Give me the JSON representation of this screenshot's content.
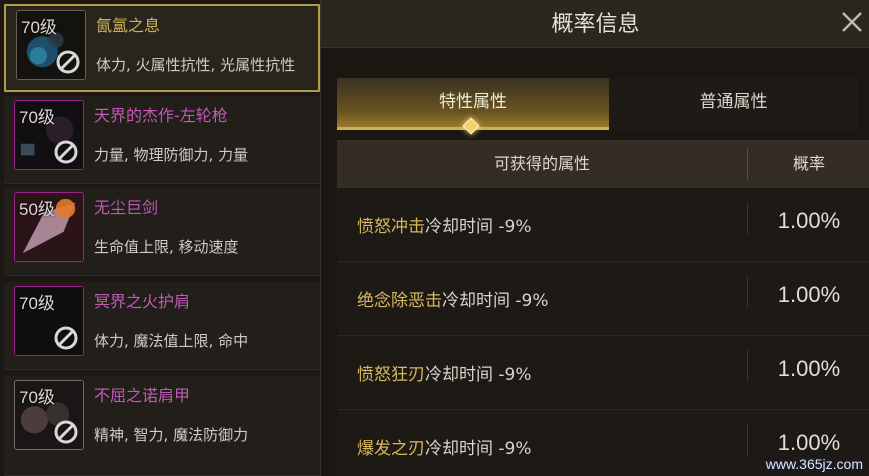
{
  "item_list": [
    {
      "level": "70级",
      "name": "氤氲之息",
      "stats": "体力, 火属性抗性, 光属性抗性",
      "name_color": "gold",
      "selected": true
    },
    {
      "level": "70级",
      "name": "天界的杰作-左轮枪",
      "stats": "力量, 物理防御力, 力量",
      "name_color": "magenta",
      "selected": false
    },
    {
      "level": "50级",
      "name": "无尘巨剑",
      "stats": "生命值上限, 移动速度",
      "name_color": "magenta",
      "selected": false
    },
    {
      "level": "70级",
      "name": "冥界之火护肩",
      "stats": "体力, 魔法值上限, 命中",
      "name_color": "magenta",
      "selected": false
    },
    {
      "level": "70级",
      "name": "不屈之诺肩甲",
      "stats": "精神, 智力, 魔法防御力",
      "name_color": "magenta",
      "selected": false
    }
  ],
  "modal": {
    "title": "概率信息",
    "tabs": [
      {
        "label": "特性属性",
        "active": true
      },
      {
        "label": "普通属性",
        "active": false
      }
    ],
    "table_headers": {
      "attribute": "可获得的属性",
      "probability": "概率"
    },
    "rows": [
      {
        "skill": "愤怒冲击",
        "effect": "冷却时间 -9%",
        "probability": "1.00%"
      },
      {
        "skill": "绝念除恶击",
        "effect": "冷却时间 -9%",
        "probability": "1.00%"
      },
      {
        "skill": "愤怒狂刃",
        "effect": "冷却时间 -9%",
        "probability": "1.00%"
      },
      {
        "skill": "爆发之刃",
        "effect": "冷却时间 -9%",
        "probability": "1.00%"
      }
    ]
  },
  "watermark": "www.365jz.com",
  "colors": {
    "gold_text": "#d6b760",
    "magenta_text": "#c05ab6",
    "tab_underline": "#d4b04a"
  }
}
